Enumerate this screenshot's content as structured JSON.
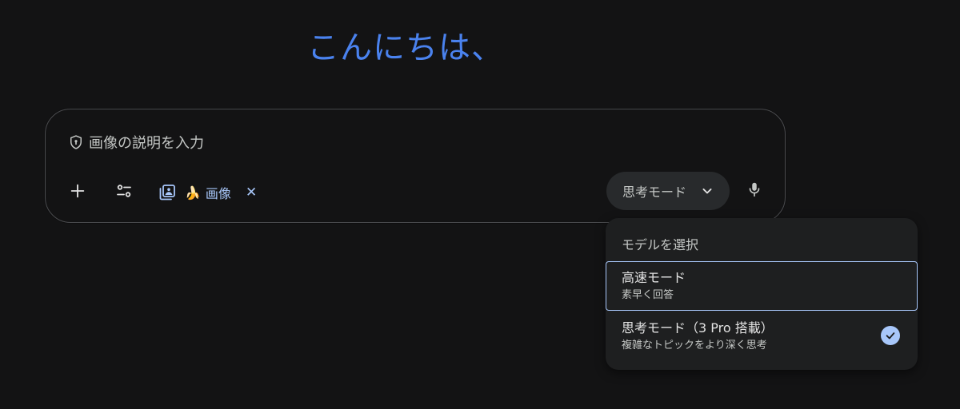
{
  "greeting": "こんにちは、",
  "composer": {
    "placeholder": "画像の説明を入力",
    "chip": {
      "emoji": "🍌",
      "label": "画像",
      "close": "✕"
    },
    "mode_button_label": "思考モード"
  },
  "model_menu": {
    "header": "モデルを選択",
    "items": [
      {
        "title": "高速モード",
        "subtitle": "素早く回答",
        "selected": false
      },
      {
        "title": "思考モード（3 Pro 搭載）",
        "subtitle": "複雑なトピックをより深く思考",
        "selected": true
      }
    ]
  },
  "colors": {
    "background": "#131314",
    "greeting": "#4a82ee",
    "accent": "#a8c7fa",
    "menu_bg": "#1e1f20",
    "pill_bg": "#282a2c"
  },
  "icons": {
    "prompt": "shield-icon",
    "add": "plus-icon",
    "tools": "tools-icon",
    "chip": "image-icon",
    "dropdown": "chevron-down-icon",
    "voice": "microphone-icon",
    "selected": "check-icon"
  }
}
